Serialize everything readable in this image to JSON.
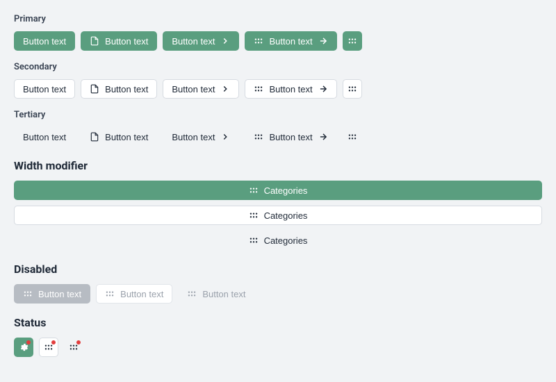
{
  "sections": {
    "primary": {
      "label": "Primary",
      "button_label": "Button text"
    },
    "secondary": {
      "label": "Secondary",
      "button_label": "Button text"
    },
    "tertiary": {
      "label": "Tertiary",
      "button_label": "Button text"
    },
    "width": {
      "heading": "Width modifier",
      "button_label": "Categories"
    },
    "disabled": {
      "heading": "Disabled",
      "button_label": "Button text"
    },
    "status": {
      "heading": "Status"
    }
  },
  "colors": {
    "primary": "#5a9e7f",
    "status_dot": "#e23d3d",
    "page_bg": "#f1f3f5"
  }
}
